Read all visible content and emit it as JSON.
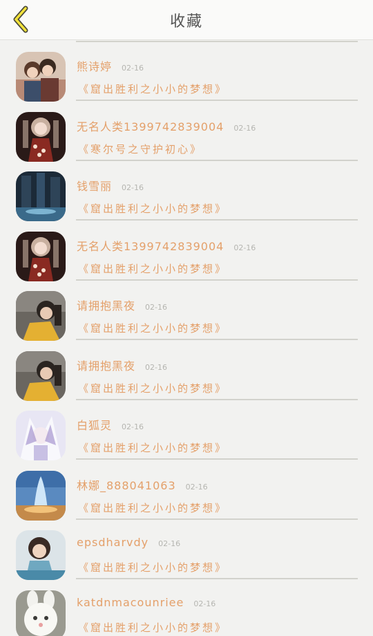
{
  "header": {
    "title": "收藏"
  },
  "items": [
    {
      "name": "熊诗婷",
      "date": "02-16",
      "title": "《窟出胜利之小小的梦想》",
      "avatar": "avatar-couple"
    },
    {
      "name": "无名人类1399742839004",
      "date": "02-16",
      "title": "《寒尔号之守护初心》",
      "avatar": "avatar-anime-girl"
    },
    {
      "name": "钱雪丽",
      "date": "02-16",
      "title": "《窟出胜利之小小的梦想》",
      "avatar": "avatar-dark-scene"
    },
    {
      "name": "无名人类1399742839004",
      "date": "02-16",
      "title": "《窟出胜利之小小的梦想》",
      "avatar": "avatar-anime-girl"
    },
    {
      "name": "请拥抱黑夜",
      "date": "02-16",
      "title": "《窟出胜利之小小的梦想》",
      "avatar": "avatar-girl-yellow"
    },
    {
      "name": "请拥抱黑夜",
      "date": "02-16",
      "title": "《窟出胜利之小小的梦想》",
      "avatar": "avatar-girl-yellow"
    },
    {
      "name": "白狐灵",
      "date": "02-16",
      "title": "《窟出胜利之小小的梦想》",
      "avatar": "avatar-white-fox"
    },
    {
      "name": "林娜_888041063",
      "date": "02-16",
      "title": "《窟出胜利之小小的梦想》",
      "avatar": "avatar-geyser"
    },
    {
      "name": "epsdharvdy",
      "date": "02-16",
      "title": "《窟出胜利之小小的梦想》",
      "avatar": "avatar-woman-photo"
    },
    {
      "name": "katdnmacounriee",
      "date": "02-16",
      "title": "《窟出胜利之小小的梦想》",
      "avatar": "avatar-white-rabbit"
    }
  ]
}
